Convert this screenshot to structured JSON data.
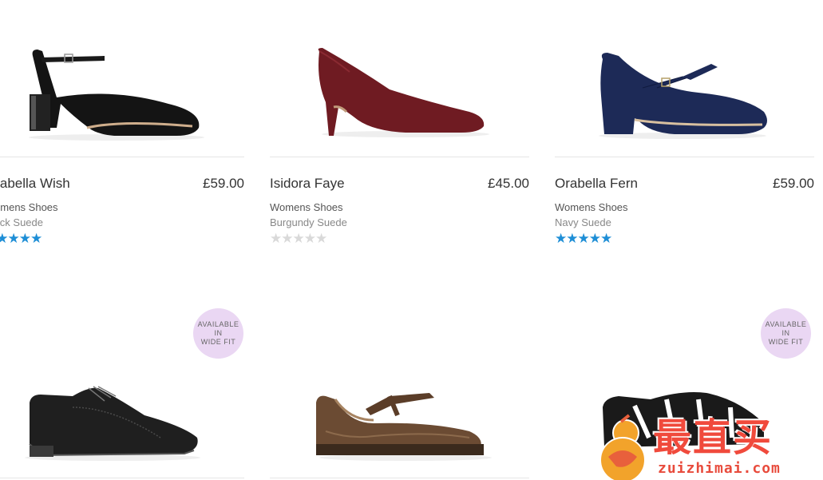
{
  "products": [
    {
      "name": "Orabella Wish",
      "price": "£59.00",
      "category": "Womens Shoes",
      "colour": "Black Suede",
      "rating": 5,
      "stars": [
        "★",
        "★",
        "★",
        "★",
        "★"
      ]
    },
    {
      "name": "Isidora Faye",
      "price": "£45.00",
      "category": "Womens Shoes",
      "colour": "Burgundy Suede",
      "rating": 0,
      "stars": [
        "★",
        "★",
        "★",
        "★",
        "★"
      ]
    },
    {
      "name": "Orabella Fern",
      "price": "£59.00",
      "category": "Womens Shoes",
      "colour": "Navy Suede",
      "rating": 5,
      "stars": [
        "★",
        "★",
        "★",
        "★",
        "★"
      ]
    },
    {
      "badge": {
        "line1": "AVAILABLE",
        "line2": "IN",
        "line3": "WIDE FIT"
      },
      "image": "black-leather-brogue"
    },
    {
      "image": "bronze-metallic-t-bar-shoe"
    },
    {
      "badge": {
        "line1": "AVAILABLE",
        "line2": "IN",
        "line3": "WIDE FIT"
      },
      "image": "black-sandal"
    }
  ],
  "colors": {
    "star_on": "#1e8ed6",
    "star_off": "#d9d9d9",
    "badge_bg": "#ead7f3"
  },
  "watermark": {
    "cn": "最直买",
    "en": "zuizhimai.com"
  }
}
